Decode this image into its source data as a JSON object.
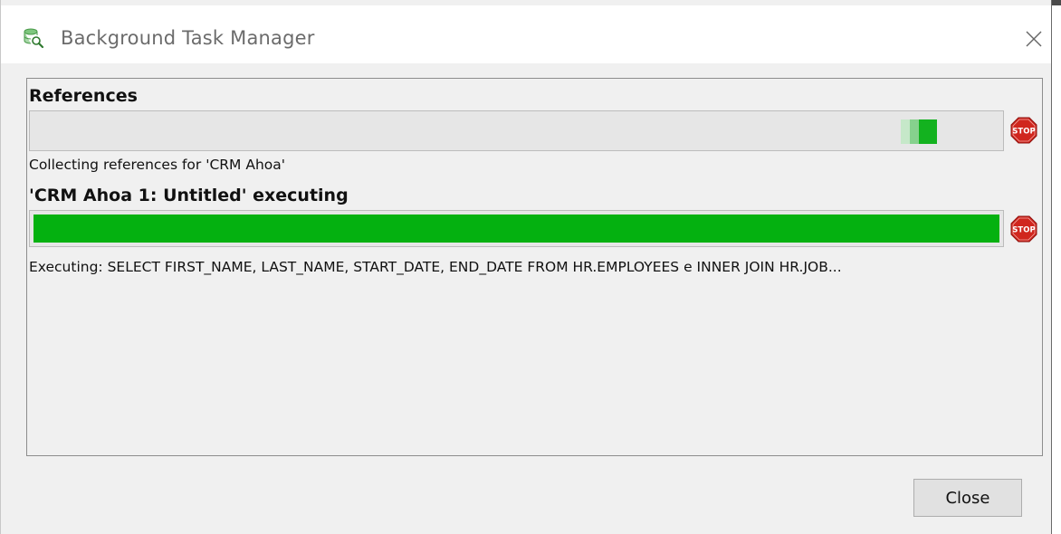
{
  "window": {
    "title": "Background Task Manager",
    "app_icon": "database-search-icon",
    "close_icon": "close-icon"
  },
  "tasks": [
    {
      "title": "References",
      "progress_mode": "indeterminate",
      "status": "Collecting references for 'CRM Ahoa'",
      "stop_icon": "stop-sign-icon",
      "stop_label": "STOP"
    },
    {
      "title": "'CRM Ahoa 1: Untitled' executing",
      "progress_mode": "determinate",
      "progress": 1.0,
      "status": "Executing: SELECT FIRST_NAME, LAST_NAME, START_DATE, END_DATE FROM HR.EMPLOYEES e INNER JOIN HR.JOB...",
      "stop_icon": "stop-sign-icon",
      "stop_label": "STOP"
    }
  ],
  "footer": {
    "close_label": "Close"
  },
  "colors": {
    "progress_green": "#04b110",
    "stop_red": "#d0261e",
    "track": "#e6e6e6"
  }
}
